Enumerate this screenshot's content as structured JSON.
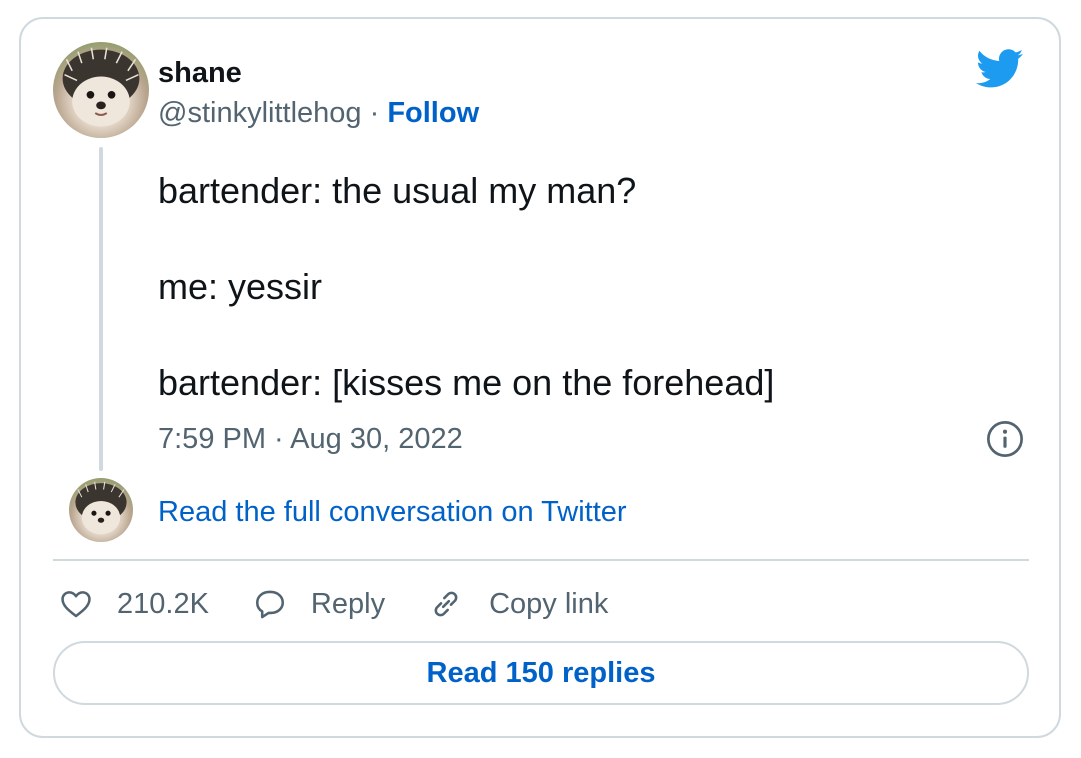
{
  "author": {
    "display_name": "shane",
    "handle": "@stinkylittlehog",
    "separator": " · ",
    "follow_label": "Follow",
    "avatar_icon": "hedgehog-avatar"
  },
  "tweet": {
    "lines": [
      "bartender: the usual my man?",
      "me: yessir",
      "bartender: [kisses me on the forehead]"
    ],
    "time": "7:59 PM",
    "date_separator": " · ",
    "date": "Aug 30, 2022"
  },
  "conversation": {
    "link_label": "Read the full conversation on Twitter"
  },
  "actions": {
    "like_count": "210.2K",
    "reply_label": "Reply",
    "copy_label": "Copy link"
  },
  "replies_button": {
    "label": "Read 150 replies"
  },
  "icons": {
    "brand": "twitter-bird-icon",
    "info": "info-icon",
    "like": "heart-icon",
    "reply": "speech-bubble-icon",
    "copy": "link-icon"
  },
  "colors": {
    "accent_blue": "#0062c9",
    "twitter_blue": "#1d9bf0",
    "text_primary": "#0f1419",
    "text_secondary": "#536471",
    "border": "#cfd9de"
  }
}
